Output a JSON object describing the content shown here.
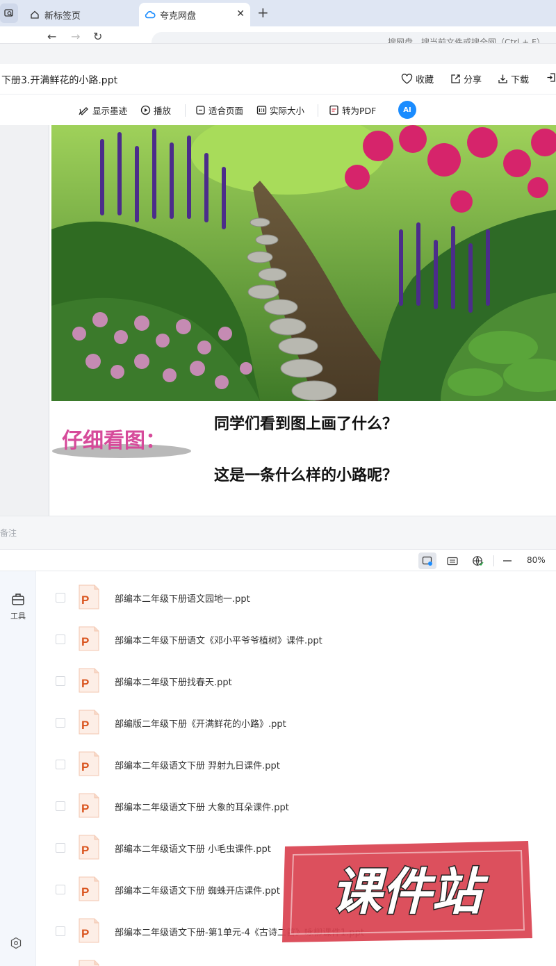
{
  "browser": {
    "tabs": [
      {
        "label": "新标签页",
        "icon": "home-icon"
      },
      {
        "label": "夸克网盘",
        "icon": "cloud-icon",
        "active": true
      }
    ],
    "new_tab_symbol": "+",
    "close_symbol": "✕",
    "address_hint": "搜网盘，搜当前文件或搜全网（Ctrl + F）"
  },
  "file": {
    "name": "下册3.开满鲜花的小路.ppt",
    "actions": {
      "favorite": "收藏",
      "share": "分享",
      "download": "下载"
    }
  },
  "toolbar": {
    "show_ink": "显示墨迹",
    "play": "播放",
    "fit_page": "适合页面",
    "actual_size": "实际大小",
    "to_pdf": "转为PDF",
    "ai": "AI"
  },
  "slide": {
    "look_label": "仔细看图：",
    "question1": "同学们看到图上画了什么？",
    "question2": "这是一条什么样的小路呢？"
  },
  "notes_label": "备注",
  "statusbar": {
    "zoom": "80%"
  },
  "rail": {
    "tool_label": "工具"
  },
  "files": [
    "部编本二年级下册语文园地一.ppt",
    "部编本二年级下册语文《邓小平爷爷植树》课件.ppt",
    "部编本二年级下册找春天.ppt",
    "部编版二年级下册《开满鲜花的小路》.ppt",
    "部编本二年级语文下册  羿射九日课件.ppt",
    "部编本二年级语文下册 大象的耳朵课件.ppt",
    "部编本二年级语文下册 小毛虫课件.ppt",
    "部编本二年级语文下册 蜘蛛开店课件.ppt",
    "部编本二年级语文下册-第1单元-4《古诗二首》咏柳课件1.ppt"
  ],
  "ppt_icon_letter": "P",
  "watermark_text": "课件站",
  "colors": {
    "accent": "#1a8cff",
    "ppt_orange": "#d9541e",
    "watermark_red": "#d9414f"
  }
}
